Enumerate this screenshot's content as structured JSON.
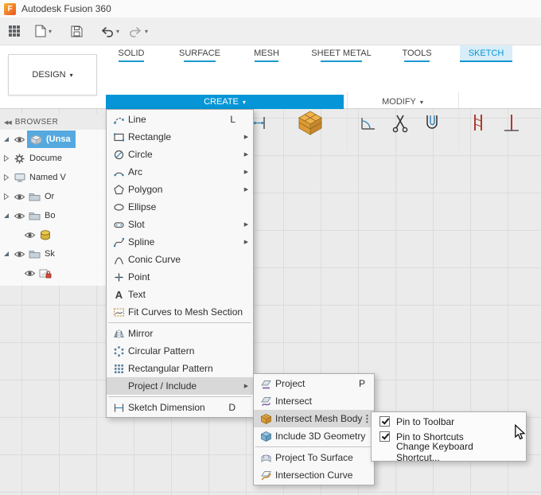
{
  "window": {
    "title": "Autodesk Fusion 360"
  },
  "tabs": [
    {
      "label": "SOLID",
      "active": false
    },
    {
      "label": "SURFACE",
      "active": false
    },
    {
      "label": "MESH",
      "active": false
    },
    {
      "label": "SHEET METAL",
      "active": false
    },
    {
      "label": "TOOLS",
      "active": false
    },
    {
      "label": "SKETCH",
      "active": true
    }
  ],
  "design_menu": {
    "label": "DESIGN"
  },
  "toolbar_groups": {
    "create_label": "CREATE",
    "modify_label": "MODIFY"
  },
  "toolbar_tools": {
    "create": [
      "line",
      "rectangle",
      "circle",
      "spline",
      "mirror",
      "dimension",
      "mesh-section"
    ],
    "modify": [
      "fillet",
      "trim",
      "offset"
    ],
    "constraints": [
      "horizontal-vertical",
      "perpendicular"
    ]
  },
  "browser": {
    "header": "BROWSER",
    "items": [
      {
        "label": "(Unsa",
        "icon": "document-icon",
        "state": "expanded",
        "eye": true,
        "selected": true
      },
      {
        "label": "Docume",
        "icon": "gear-icon",
        "state": "collapsed",
        "eye": false,
        "selected": false
      },
      {
        "label": "Named V",
        "icon": "named-views-icon",
        "state": "collapsed",
        "eye": false,
        "selected": false
      },
      {
        "label": "Or",
        "icon": "folder-icon",
        "state": "collapsed",
        "eye": true,
        "selected": false
      },
      {
        "label": "Bo",
        "icon": "folder-icon",
        "state": "expanded",
        "eye": true,
        "selected": false
      },
      {
        "label": "",
        "icon": "body-cylinder-icon",
        "state": "leaf",
        "eye": true,
        "selected": false
      },
      {
        "label": "Sk",
        "icon": "folder-icon",
        "state": "expanded",
        "eye": true,
        "selected": false
      },
      {
        "label": "",
        "icon": "sketch-locked-icon",
        "state": "leaf",
        "eye": true,
        "selected": false
      }
    ]
  },
  "create_menu": {
    "label": "CREATE",
    "items": [
      {
        "label": "Line",
        "shortcut": "L",
        "icon": "line-icon"
      },
      {
        "label": "Rectangle",
        "icon": "rectangle-icon",
        "submenu": true
      },
      {
        "label": "Circle",
        "icon": "circle-icon",
        "submenu": true
      },
      {
        "label": "Arc",
        "icon": "arc-icon",
        "submenu": true
      },
      {
        "label": "Polygon",
        "icon": "polygon-icon",
        "submenu": true
      },
      {
        "label": "Ellipse",
        "icon": "ellipse-icon"
      },
      {
        "label": "Slot",
        "icon": "slot-icon",
        "submenu": true
      },
      {
        "label": "Spline",
        "icon": "spline-icon",
        "submenu": true
      },
      {
        "label": "Conic Curve",
        "icon": "conic-curve-icon"
      },
      {
        "label": "Point",
        "icon": "point-icon"
      },
      {
        "label": "Text",
        "icon": "text-icon"
      },
      {
        "label": "Fit Curves to Mesh Section",
        "icon": "fit-curves-icon",
        "separator_after": true
      },
      {
        "label": "Mirror",
        "icon": "mirror-icon"
      },
      {
        "label": "Circular Pattern",
        "icon": "circular-pattern-icon"
      },
      {
        "label": "Rectangular Pattern",
        "icon": "rectangular-pattern-icon"
      },
      {
        "label": "Project / Include",
        "submenu": true,
        "highlighted": true,
        "separator_after": true
      },
      {
        "label": "Sketch Dimension",
        "shortcut": "D",
        "icon": "sketch-dimension-icon"
      }
    ]
  },
  "project_submenu": {
    "items": [
      {
        "label": "Project",
        "shortcut": "P",
        "icon": "project-icon"
      },
      {
        "label": "Intersect",
        "icon": "intersect-icon"
      },
      {
        "label": "Intersect Mesh Body",
        "icon": "intersect-mesh-body-icon",
        "highlighted": true,
        "more_options": true
      },
      {
        "label": "Include 3D Geometry",
        "icon": "include-3d-geometry-icon",
        "separator_after": true
      },
      {
        "label": "Project To Surface",
        "icon": "project-to-surface-icon"
      },
      {
        "label": "Intersection Curve",
        "icon": "intersection-curve-icon"
      }
    ]
  },
  "context_menu": {
    "items": [
      {
        "label": "Pin to Toolbar",
        "checked": true
      },
      {
        "label": "Pin to Shortcuts",
        "checked": true
      },
      {
        "label": "Change Keyboard Shortcut...",
        "checked": false
      }
    ]
  },
  "colors": {
    "accent_blue": "#0696d7",
    "menu_highlight": "#d8d8d8",
    "selection_blue": "#55a9df",
    "mesh_orange": "#e0a33e",
    "canvas_grey": "#ebebeb"
  }
}
